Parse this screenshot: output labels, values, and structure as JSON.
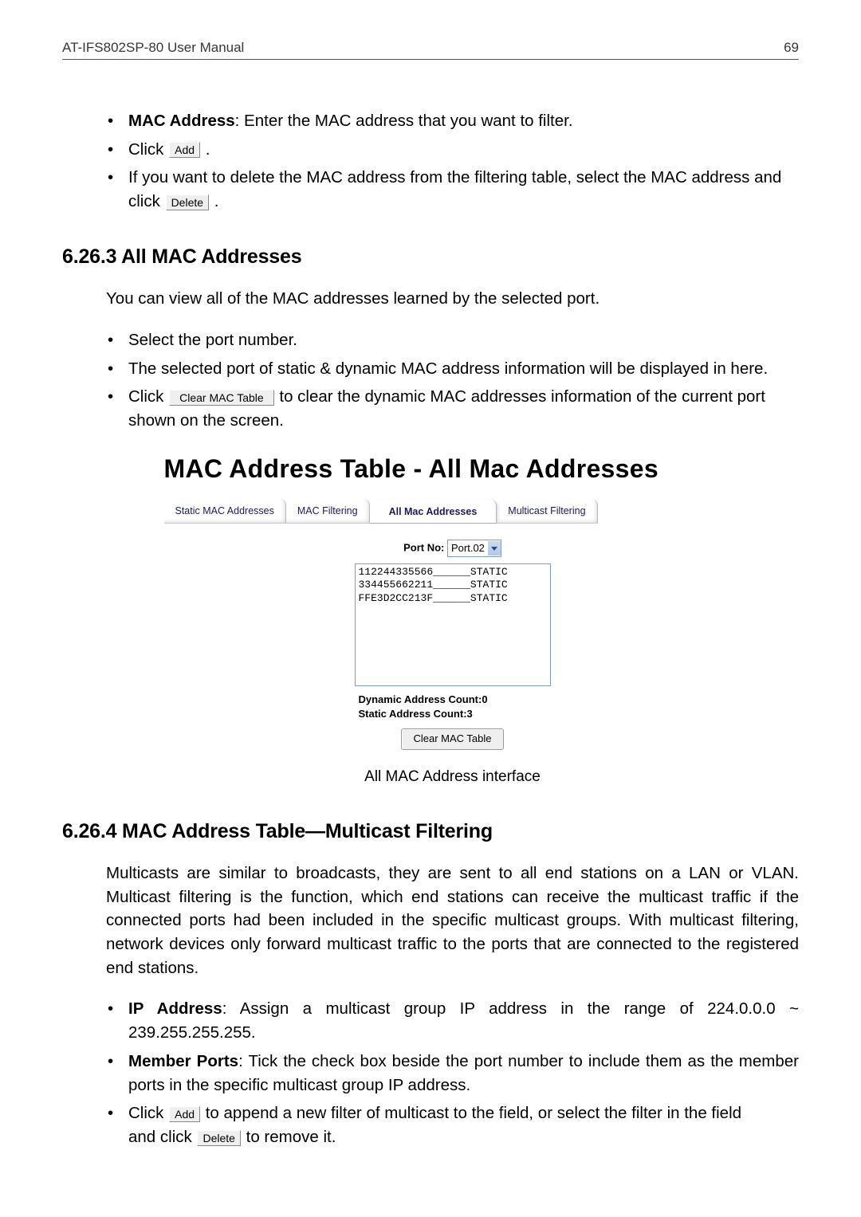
{
  "header": {
    "doc_title": "AT-IFS802SP-80 User Manual",
    "page_number": "69"
  },
  "top_bullets": {
    "item1_strong": "MAC Address",
    "item1_rest": ": Enter the MAC address that you want to filter.",
    "item2_pre": "Click ",
    "item2_btn": "Add",
    "item2_post": " .",
    "item3_line1": "If you want to delete the MAC address from the filtering table, select the MAC address and",
    "item3_line2_pre": "click ",
    "item3_btn": "Delete",
    "item3_line2_post": " ."
  },
  "section1": {
    "heading": "6.26.3  All MAC Addresses",
    "para": "You can view all of the MAC addresses learned by the selected port.",
    "b1": "Select the port number.",
    "b2": "The selected port of static & dynamic MAC address information will be displayed in here.",
    "b3_pre": "Click ",
    "b3_btn": "Clear MAC Table",
    "b3_post": " to clear the dynamic MAC addresses information of the current port",
    "b3_line2": "shown on the screen."
  },
  "figure": {
    "title": "MAC Address Table - All Mac Addresses",
    "tabs": {
      "t1": "Static MAC Addresses",
      "t2": "MAC Filtering",
      "t3": "All Mac Addresses",
      "t4": "Multicast Filtering"
    },
    "port_label": "Port No:",
    "port_value": "Port.02",
    "listbox_text": "112244335566______STATIC\n334455662211______STATIC\nFFE3D2CC213F______STATIC",
    "dynamic_count_label": "Dynamic Address Count:",
    "dynamic_count_value": "0",
    "static_count_label": "Static Address Count:",
    "static_count_value": "3",
    "clear_btn": "Clear MAC Table",
    "caption": "All MAC Address interface"
  },
  "section2": {
    "heading": "6.26.4  MAC Address Table—Multicast Filtering",
    "para": "Multicasts are similar to broadcasts, they are sent to all end stations on a LAN or VLAN. Multicast filtering is the function, which end stations can receive the multicast traffic if the connected ports had been included in the specific multicast groups. With multicast filtering, network devices only forward multicast traffic to the ports that are connected to the registered end stations.",
    "b1_strong": "IP Address",
    "b1_rest": ": Assign a multicast group IP address in the range of 224.0.0.0 ~ 239.255.255.255.",
    "b2_strong": "Member Ports",
    "b2_rest": ": Tick the check box beside the port number to include them as the member ports in the specific multicast group IP address.",
    "b3_pre": "Click ",
    "b3_add": "Add",
    "b3_mid": " to append a new filter of multicast to the field, or select the filter in the field",
    "b3_line2_pre": "and click ",
    "b3_del": "Delete",
    "b3_line2_post": " to remove it."
  }
}
